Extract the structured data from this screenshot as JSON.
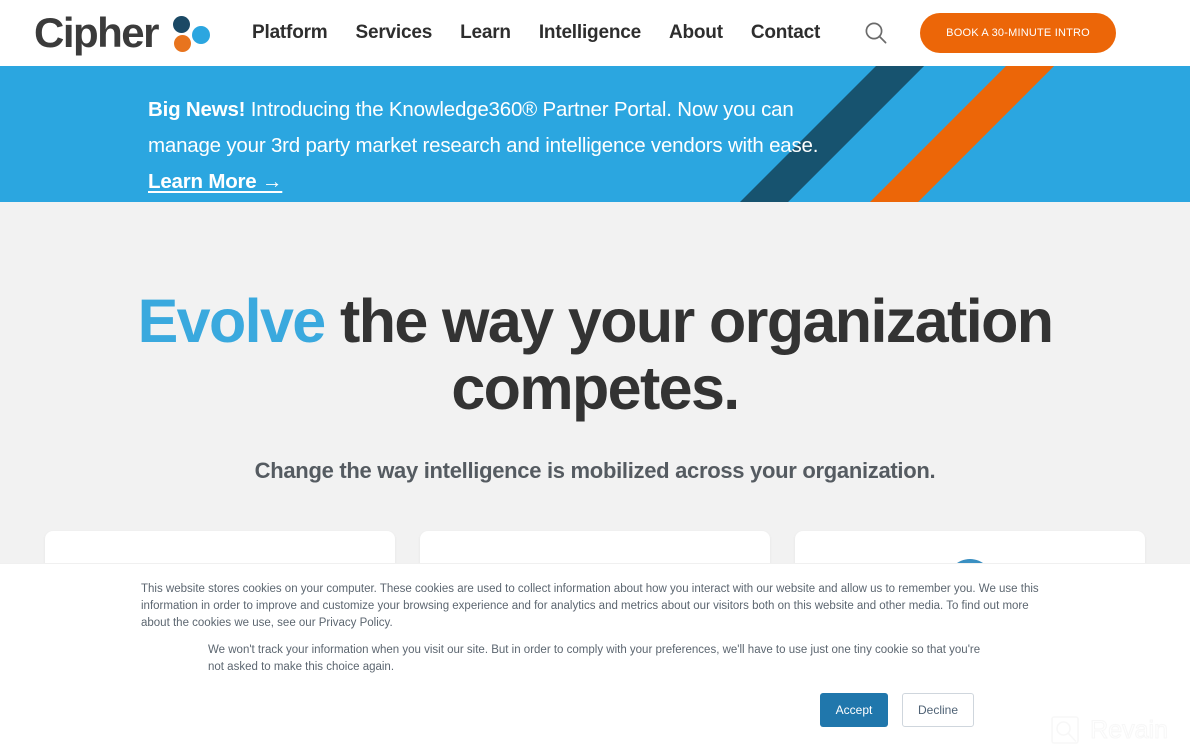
{
  "header": {
    "logo_text": "Cipher",
    "logo_dots": [
      "navy-dot",
      "blue-dot",
      "orange-dot"
    ],
    "nav_items": [
      {
        "label": "Platform"
      },
      {
        "label": "Services"
      },
      {
        "label": "Learn"
      },
      {
        "label": "Intelligence"
      },
      {
        "label": "About"
      },
      {
        "label": "Contact"
      }
    ],
    "search_icon": "search-icon",
    "cta_label": "BOOK A 30-MINUTE INTRO",
    "cta_color": "#ec6608"
  },
  "banner": {
    "background_color": "#2ba6e0",
    "badge_text": "Big News!",
    "body_text": " Introducing the Knowledge360® Partner Portal. Now you can manage your 3rd party market research and intelligence vendors with ease. ",
    "link_label": "Learn More →",
    "stripe_colors": [
      "#17536f",
      "#ec6608"
    ]
  },
  "hero": {
    "title_accent": "Evolve",
    "title_rest": " the way your organization competes.",
    "accent_color": "#3aa9de",
    "subtitle": "Change the way intelligence is mobilized across your organization."
  },
  "cards": [
    {
      "name": "feature-card-1",
      "icon": ""
    },
    {
      "name": "feature-card-2",
      "icon": ""
    },
    {
      "name": "feature-card-3",
      "icon": "globe-icon"
    }
  ],
  "cookie_banner": {
    "paragraph_1": "This website stores cookies on your computer. These cookies are used to collect information about how you interact with our website and allow us to remember you. We use this information in order to improve and customize your browsing experience and for analytics and metrics about our visitors both on this website and other media. To find out more about the cookies we use, see our Privacy Policy.",
    "paragraph_2": "We won't track your information when you visit our site. But in order to comply with your preferences, we'll have to use just one tiny cookie so that you're not asked to make this choice again.",
    "accept_label": "Accept",
    "decline_label": "Decline",
    "accept_color": "#2077ac"
  },
  "watermark": {
    "icon": "revain-logo-icon",
    "label": "Revain"
  }
}
